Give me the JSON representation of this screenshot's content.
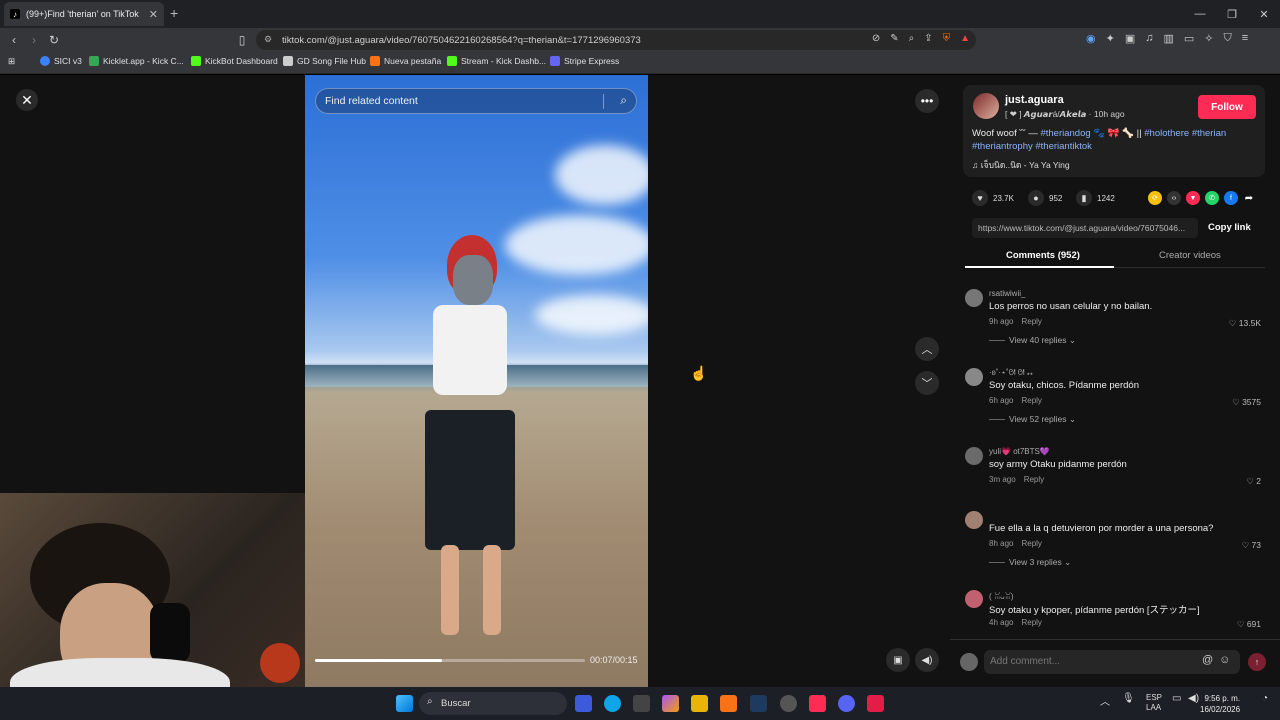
{
  "browser": {
    "tab_title": "(99+)Find 'therian' on TikTok",
    "url": "tiktok.com/@just.aguara/video/7607504622160268564?q=therian&t=1771296960373",
    "bookmarks": [
      {
        "label": "SICI v3",
        "color": "#3b82f6"
      },
      {
        "label": "Kicklet.app - Kick C...",
        "color": "#3aa655"
      },
      {
        "label": "KickBot Dashboard",
        "color": "#53fc18"
      },
      {
        "label": "GD Song File Hub",
        "color": "#cccccc"
      },
      {
        "label": "Nueva pestaña",
        "color": "#f97316"
      },
      {
        "label": "Stream - Kick Dashb...",
        "color": "#53fc18"
      },
      {
        "label": "Stripe Express",
        "color": "#6366f1"
      }
    ]
  },
  "video": {
    "search_placeholder": "Find related content",
    "time": "00:07/00:15",
    "progress": 0.47
  },
  "post": {
    "username": "just.aguara",
    "subname": "[ ❤ ] 𝘼𝙜𝙪𝙖𝙧á/𝘼𝙠𝙚𝙡𝙖 · 10h ago",
    "follow_label": "Follow",
    "desc_text": "Woof woof ˘˘ — ",
    "tags": [
      "#theriandog",
      "#holothere",
      "#therian",
      "#theriantrophy",
      "#theriantiktok"
    ],
    "desc_mid": " 🐾 🎀 🦴 || ",
    "music": "♫ เจ็บนิด..นิด - Ya Ya Ying",
    "likes": "23.7K",
    "comments": "952",
    "saves": "1242",
    "share_link": "https://www.tiktok.com/@just.aguara/video/76075046...",
    "copy_label": "Copy link",
    "tab_comments": "Comments (952)",
    "tab_creator": "Creator videos"
  },
  "comments": [
    {
      "name": "rsatiwiwii_",
      "text": "Los perros no usan celular y no bailan.",
      "time": "9h ago",
      "reply": "Reply",
      "likes": "13.5K",
      "replies": "View 40 replies"
    },
    {
      "name": "·ʚ˚·⋆˚ᘛ ᘛ ⁎⁎",
      "text": "Soy otaku, chicos. Pídanme perdón",
      "time": "6h ago",
      "reply": "Reply",
      "likes": "3575",
      "replies": "View 52 replies"
    },
    {
      "name": "yuli💗 ot7BTS💜",
      "text": "soy army Otaku pidanme perdón",
      "time": "3m ago",
      "reply": "Reply",
      "likes": "2",
      "replies": ""
    },
    {
      "name": "",
      "text": "Fue ella a la q detuvieron por morder a una persona?",
      "time": "8h ago",
      "reply": "Reply",
      "likes": "73",
      "replies": "View 3 replies"
    },
    {
      "name": "( ꈍᴗꈍ)",
      "text": "Soy otaku y kpoper, pídanme perdón [ステッカー]",
      "time": "4h ago",
      "reply": "Reply",
      "likes": "691",
      "replies": ""
    }
  ],
  "add_comment_placeholder": "Add comment...",
  "taskbar": {
    "search_label": "Buscar",
    "lang_top": "ESP",
    "lang_bottom": "LAA",
    "time": "9:56 p. m.",
    "date": "16/02/2026"
  }
}
